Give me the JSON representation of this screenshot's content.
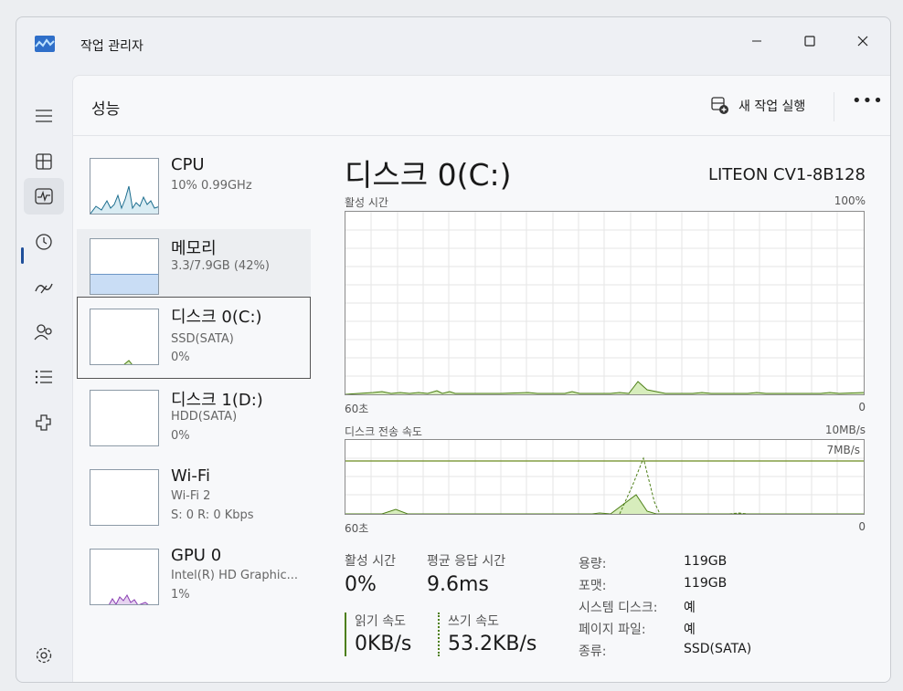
{
  "window": {
    "title": "작업 관리자"
  },
  "header": {
    "page_title": "성능",
    "new_task_label": "새 작업 실행",
    "more_label": "•••"
  },
  "nav": {
    "items": [
      {
        "name": "menu-icon"
      },
      {
        "name": "processes-icon"
      },
      {
        "name": "performance-icon",
        "active": true
      },
      {
        "name": "app-history-icon"
      },
      {
        "name": "startup-icon"
      },
      {
        "name": "users-icon"
      },
      {
        "name": "details-icon"
      },
      {
        "name": "services-icon"
      },
      {
        "name": "settings-icon"
      }
    ]
  },
  "resources": [
    {
      "name": "CPU",
      "line1": "10% 0.99GHz",
      "line2": ""
    },
    {
      "name": "메모리",
      "line1": "3.3/7.9GB (42%)",
      "line2": ""
    },
    {
      "name": "디스크 0(C:)",
      "line1": "SSD(SATA)",
      "line2": "0%"
    },
    {
      "name": "디스크 1(D:)",
      "line1": "HDD(SATA)",
      "line2": "0%"
    },
    {
      "name": "Wi-Fi",
      "line1": "Wi-Fi 2",
      "line2": "S: 0 R: 0 Kbps"
    },
    {
      "name": "GPU 0",
      "line1": "Intel(R) HD Graphic...",
      "line2": "1%"
    }
  ],
  "detail": {
    "title": "디스크 0(C:)",
    "model": "LITEON CV1-8B128",
    "graph1": {
      "label": "활성 시간",
      "max": "100%",
      "x_left": "60초",
      "x_right": "0"
    },
    "graph2": {
      "label": "디스크 전송 속도",
      "max": "10MB/s",
      "inner_label": "7MB/s",
      "x_left": "60초",
      "x_right": "0"
    },
    "stats": {
      "active_time_label": "활성 시간",
      "active_time": "0%",
      "response_label": "평균 응답 시간",
      "response": "9.6ms",
      "read_label": "읽기 속도",
      "read": "0KB/s",
      "write_label": "쓰기 속도",
      "write": "53.2KB/s"
    },
    "properties": [
      {
        "key": "용량:",
        "value": "119GB"
      },
      {
        "key": "포맷:",
        "value": "119GB"
      },
      {
        "key": "시스템 디스크:",
        "value": "예"
      },
      {
        "key": "페이지 파일:",
        "value": "예"
      },
      {
        "key": "종류:",
        "value": "SSD(SATA)"
      }
    ]
  },
  "colors": {
    "disk_line": "#4d7f17",
    "disk_fill": "#d7edbc",
    "cpu_line": "#1d6e8f",
    "memory_fill": "#c9ddf5",
    "gpu_line": "#8a3fb3"
  }
}
